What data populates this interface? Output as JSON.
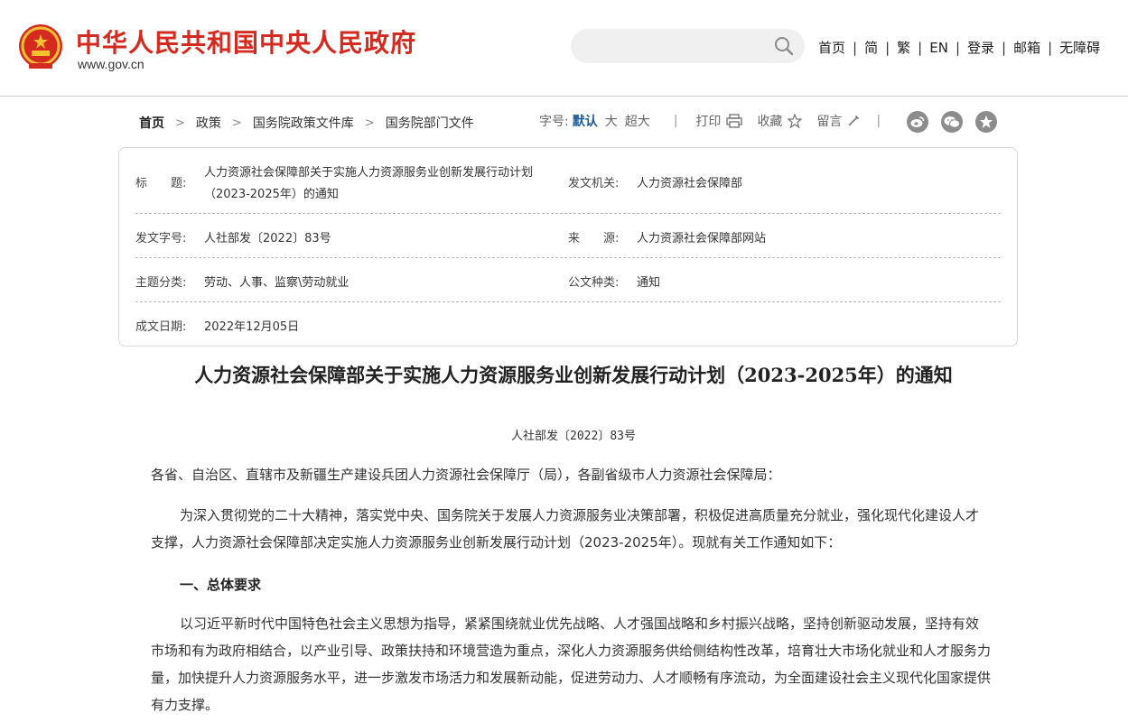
{
  "header": {
    "site_title": "中华人民共和国中央人民政府",
    "site_url": "www.gov.cn",
    "search_placeholder": "",
    "nav": [
      "首页",
      "简",
      "繁",
      "EN",
      "登录",
      "邮箱",
      "无障碍"
    ]
  },
  "breadcrumb": [
    "首页",
    "政策",
    "国务院政策文件库",
    "国务院部门文件"
  ],
  "tools": {
    "font_label": "字号:",
    "font_default": "默认",
    "font_large": "大",
    "font_xlarge": "超大",
    "print": "打印",
    "favorite": "收藏",
    "comment": "留言"
  },
  "share_icons": [
    "weibo-icon",
    "wechat-icon",
    "star-icon"
  ],
  "meta": {
    "title_label": "标　　题:",
    "title_line1": "人力资源社会保障部关于实施人力资源服务业创新发展行动计划",
    "title_line2": "（2023-2025年）的通知",
    "issuer_label": "发文机关:",
    "issuer": "人力资源社会保障部",
    "doc_no_label": "发文字号:",
    "doc_no": "人社部发〔2022〕83号",
    "source_label": "来　　源:",
    "source": "人力资源社会保障部网站",
    "topic_label": "主题分类:",
    "topic": "劳动、人事、监察\\劳动就业",
    "type_label": "公文种类:",
    "type": "通知",
    "date_label": "成文日期:",
    "date": "2022年12月05日"
  },
  "document": {
    "title": "人力资源社会保障部关于实施人力资源服务业创新发展行动计划（2023-2025年）的通知",
    "number": "人社部发〔2022〕83号",
    "addressee": "各省、自治区、直辖市及新疆生产建设兵团人力资源社会保障厅（局），各副省级市人力资源社会保障局：",
    "para1": "为深入贯彻党的二十大精神，落实党中央、国务院关于发展人力资源服务业决策部署，积极促进高质量充分就业，强化现代化建设人才支撑，人力资源社会保障部决定实施人力资源服务业创新发展行动计划（2023-2025年）。现就有关工作通知如下：",
    "heading1": "一、总体要求",
    "para2": "以习近平新时代中国特色社会主义思想为指导，紧紧围绕就业优先战略、人才强国战略和乡村振兴战略，坚持创新驱动发展，坚持有效市场和有为政府相结合，以产业引导、政策扶持和环境营造为重点，深化人力资源服务供给侧结构性改革，培育壮大市场化就业和人才服务力量，加快提升人力资源服务水平，进一步激发市场活力和发展新动能，促进劳动力、人才顺畅有序流动，为全面建设社会主义现代化国家提供有力支撑。"
  },
  "colors": {
    "brand_red": "#d52a1f",
    "emblem_gold": "#f2c230",
    "active_blue": "#1a5a9b"
  }
}
